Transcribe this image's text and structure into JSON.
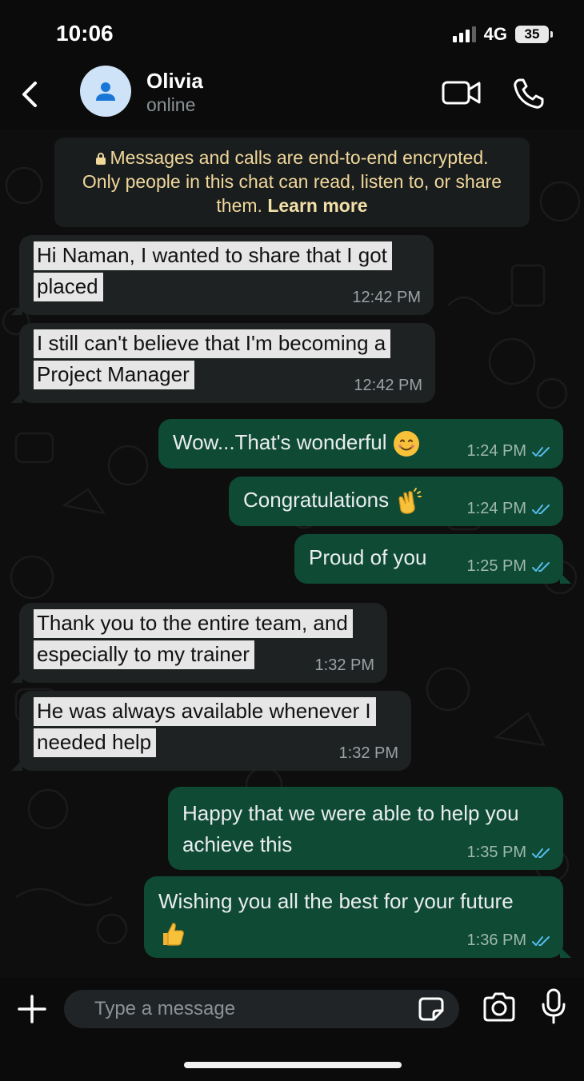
{
  "status_bar": {
    "time": "10:06",
    "network": "4G",
    "battery": "35"
  },
  "header": {
    "contact_name": "Olivia",
    "contact_status": "online"
  },
  "encryption_notice": {
    "line1": "Messages and calls are end-to-end encrypted.",
    "line2": "Only people in this chat can read, listen to, or share",
    "line3": "them.",
    "learn_more": "Learn more"
  },
  "messages": [
    {
      "direction": "incoming",
      "line1": "Hi Naman, I wanted to share that I got",
      "line2": "placed",
      "time": "12:42 PM"
    },
    {
      "direction": "incoming",
      "line1": "I still can't believe that I'm becoming a",
      "line2": "Project Manager",
      "time": "12:42 PM"
    },
    {
      "direction": "outgoing",
      "text": "Wow...That's wonderful",
      "emoji": "smiling-face-emoji",
      "time": "1:24 PM",
      "read": true
    },
    {
      "direction": "outgoing",
      "text": "Congratulations",
      "emoji": "clapping-hands-emoji",
      "time": "1:24 PM",
      "read": true
    },
    {
      "direction": "outgoing",
      "text": "Proud of you",
      "time": "1:25 PM",
      "read": true
    },
    {
      "direction": "incoming",
      "line1": "Thank you to the entire team, and",
      "line2": "especially to my trainer",
      "time": "1:32 PM"
    },
    {
      "direction": "incoming",
      "line1": "He was always available whenever I",
      "line2": "needed help",
      "time": "1:32 PM"
    },
    {
      "direction": "outgoing",
      "line1": "Happy that we were able to help you",
      "line2": "achieve this",
      "time": "1:35 PM",
      "read": true
    },
    {
      "direction": "outgoing",
      "line1": "Wishing you all the best for your future",
      "emoji": "thumbs-up-emoji",
      "time": "1:36 PM",
      "read": true
    }
  ],
  "composer": {
    "placeholder": "Type a message"
  },
  "colors": {
    "outgoing_bubble": "#0f4a35",
    "incoming_bubble": "#1f2223",
    "encryption_text": "#f0d79a",
    "read_ticks": "#53bdeb"
  }
}
